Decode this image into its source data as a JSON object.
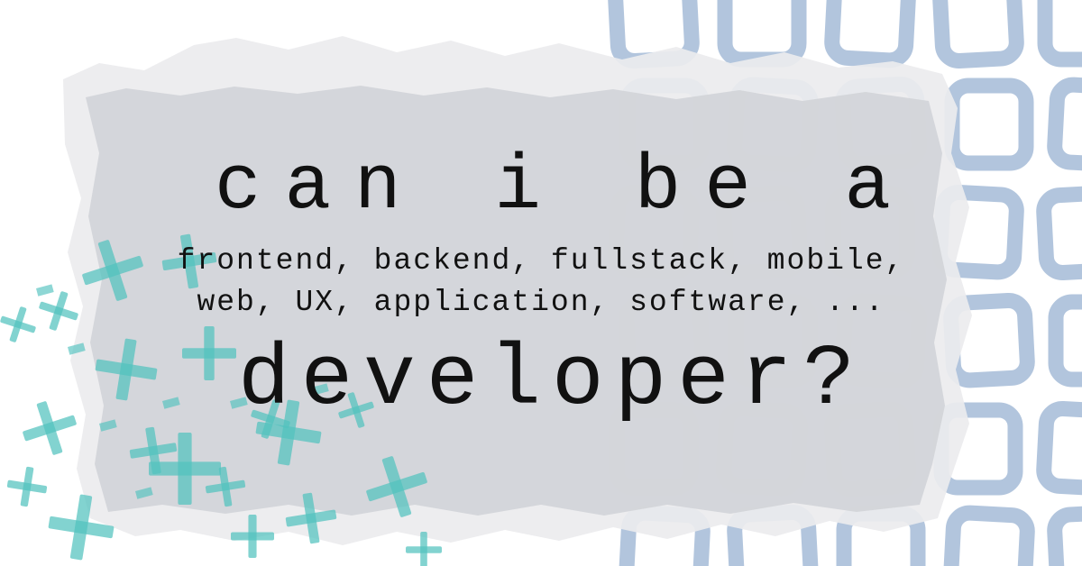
{
  "headline": {
    "line1": "can i be a",
    "roles_line1": "frontend, backend, fullstack, mobile,",
    "roles_line2": "web, UX, application, software, ...",
    "line2": "developer?"
  },
  "colors": {
    "background": "#ffffff",
    "paper_outer": "#ececee",
    "paper_inner": "#d3d5d9",
    "squares": "#7f9fc6",
    "plus_marks": "#52c2be",
    "text": "#111111"
  }
}
